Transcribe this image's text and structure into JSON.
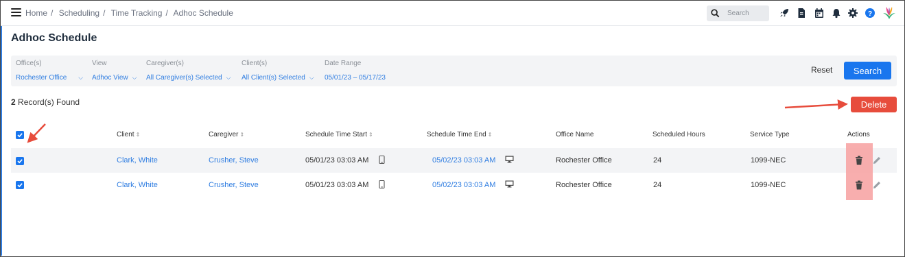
{
  "breadcrumb": [
    "Home",
    "Scheduling",
    "Time Tracking",
    "Adhoc Schedule"
  ],
  "search": {
    "placeholder": "Search"
  },
  "top_icons": [
    "rocket-icon",
    "document-icon",
    "calendar-icon",
    "bell-icon",
    "gear-icon",
    "help-icon",
    "logo-icon"
  ],
  "page_title": "Adhoc Schedule",
  "filters": {
    "office": {
      "label": "Office(s)",
      "value": "Rochester Office"
    },
    "view": {
      "label": "View",
      "value": "Adhoc View"
    },
    "caregiver": {
      "label": "Caregiver(s)",
      "value": "All Caregiver(s) Selected"
    },
    "client": {
      "label": "Client(s)",
      "value": "All Client(s) Selected"
    },
    "date_range": {
      "label": "Date Range",
      "value": "05/01/23 – 05/17/23"
    }
  },
  "buttons": {
    "reset": "Reset",
    "search": "Search",
    "delete": "Delete"
  },
  "records": {
    "count": "2",
    "suffix": " Record(s) Found"
  },
  "table": {
    "headers": {
      "client": "Client",
      "caregiver": "Caregiver",
      "start": "Schedule Time Start",
      "end": "Schedule Time End",
      "office": "Office Name",
      "hours": "Scheduled Hours",
      "service": "Service Type",
      "actions": "Actions"
    },
    "rows": [
      {
        "client": "Clark, White",
        "caregiver": "Crusher, Steve",
        "start": "05/01/23 03:03 AM",
        "end": "05/02/23 03:03 AM",
        "office": "Rochester Office",
        "hours": "24",
        "service": "1099-NEC",
        "checked": true
      },
      {
        "client": "Clark, White",
        "caregiver": "Crusher, Steve",
        "start": "05/01/23 03:03 AM",
        "end": "05/02/23 03:03 AM",
        "office": "Rochester Office",
        "hours": "24",
        "service": "1099-NEC",
        "checked": true
      }
    ]
  },
  "colors": {
    "accent": "#1976ee",
    "link": "#2f7de1",
    "delete": "#e74c3c",
    "annotation": "#e74c3c"
  }
}
